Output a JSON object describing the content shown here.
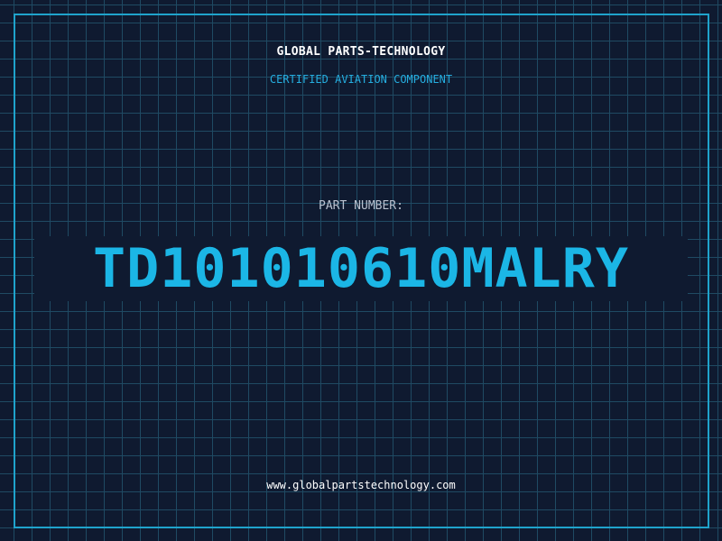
{
  "label": {
    "company": "GLOBAL PARTS-TECHNOLOGY",
    "certification": "CERTIFIED AVIATION COMPONENT",
    "part_number_label": "PART NUMBER:",
    "part_number": "TD101010610MALRY",
    "website": "www.globalpartstechnology.com"
  },
  "colors": {
    "background": "#0f1a30",
    "grid": "#1f4a63",
    "frame": "#1fa3cc",
    "accent": "#1bb6e6",
    "title": "#ffffff",
    "label": "#b9c1cf"
  }
}
